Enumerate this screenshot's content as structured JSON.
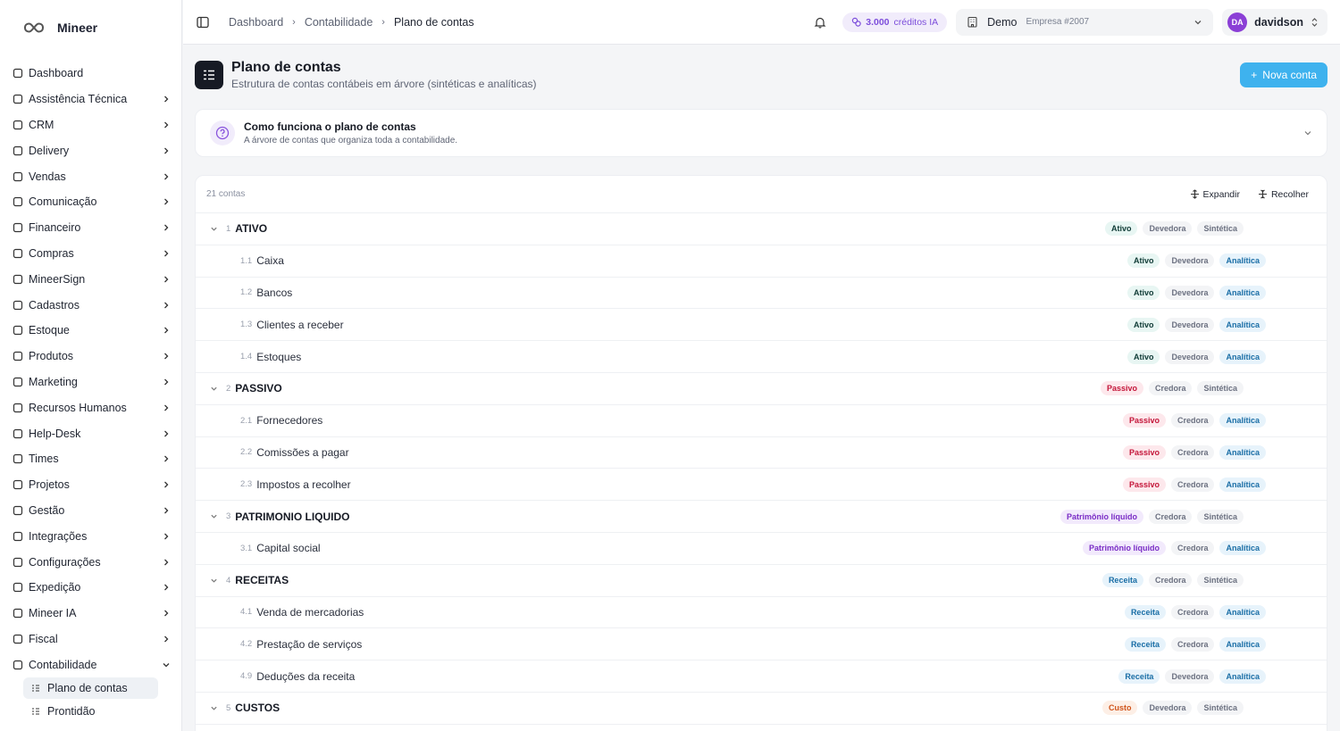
{
  "brand": {
    "name": "Mineer"
  },
  "sidebar": {
    "items": [
      {
        "label": "Dashboard",
        "icon": "dashboard-icon",
        "chevron": false
      },
      {
        "label": "Assistência Técnica",
        "icon": "wrench-icon",
        "chevron": true
      },
      {
        "label": "CRM",
        "icon": "users-icon",
        "chevron": true
      },
      {
        "label": "Delivery",
        "icon": "bike-icon",
        "chevron": true
      },
      {
        "label": "Vendas",
        "icon": "trending-up-icon",
        "chevron": true
      },
      {
        "label": "Comunicação",
        "icon": "radio-icon",
        "chevron": true
      },
      {
        "label": "Financeiro",
        "icon": "credit-card-icon",
        "chevron": true
      },
      {
        "label": "Compras",
        "icon": "cart-icon",
        "chevron": true
      },
      {
        "label": "MineerSign",
        "icon": "signature-icon",
        "chevron": true
      },
      {
        "label": "Cadastros",
        "icon": "database-icon",
        "chevron": true
      },
      {
        "label": "Estoque",
        "icon": "package-icon",
        "chevron": true
      },
      {
        "label": "Produtos",
        "icon": "box-icon",
        "chevron": true
      },
      {
        "label": "Marketing",
        "icon": "megaphone-icon",
        "chevron": true
      },
      {
        "label": "Recursos Humanos",
        "icon": "briefcase-icon",
        "chevron": true
      },
      {
        "label": "Help-Desk",
        "icon": "headset-icon",
        "chevron": true
      },
      {
        "label": "Times",
        "icon": "team-icon",
        "chevron": true
      },
      {
        "label": "Projetos",
        "icon": "folder-icon",
        "chevron": true
      },
      {
        "label": "Gestão",
        "icon": "clipboard-icon",
        "chevron": true
      },
      {
        "label": "Integrações",
        "icon": "command-icon",
        "chevron": true
      },
      {
        "label": "Configurações",
        "icon": "gear-icon",
        "chevron": true
      },
      {
        "label": "Expedição",
        "icon": "truck-icon",
        "chevron": true
      },
      {
        "label": "Mineer IA",
        "icon": "bot-icon",
        "chevron": true
      },
      {
        "label": "Fiscal",
        "icon": "receipt-icon",
        "chevron": true
      },
      {
        "label": "Contabilidade",
        "icon": "calculator-icon",
        "chevron": true,
        "expanded": true
      }
    ],
    "subitems": [
      {
        "label": "Plano de contas",
        "icon": "list-tree-icon",
        "active": true
      },
      {
        "label": "Prontidão",
        "icon": "shield-icon",
        "active": false
      }
    ]
  },
  "topbar": {
    "breadcrumbs": [
      "Dashboard",
      "Contabilidade",
      "Plano de contas"
    ],
    "credits_amount": "3.000",
    "credits_label": "créditos IA",
    "company_name": "Demo",
    "company_sub": "Empresa #2007",
    "user_initials": "DA",
    "user_name": "davidson"
  },
  "page": {
    "title": "Plano de contas",
    "subtitle": "Estrutura de contas contábeis em árvore (sintéticas e analíticas)",
    "new_button": "Nova conta"
  },
  "help": {
    "title": "Como funciona o plano de contas",
    "subtitle": "A árvore de contas que organiza toda a contabilidade."
  },
  "table": {
    "count": "21 contas",
    "expand_label": "Expandir",
    "collapse_label": "Recolher",
    "rows": [
      {
        "level": "group",
        "code": "1",
        "name": "ATIVO",
        "type": "Ativo",
        "type_class": "b-ativo",
        "nature": "Devedora",
        "kind": "Sintética"
      },
      {
        "level": "child",
        "code": "1.1",
        "name": "Caixa",
        "type": "Ativo",
        "type_class": "b-ativo",
        "nature": "Devedora",
        "kind": "Analítica"
      },
      {
        "level": "child",
        "code": "1.2",
        "name": "Bancos",
        "type": "Ativo",
        "type_class": "b-ativo",
        "nature": "Devedora",
        "kind": "Analítica"
      },
      {
        "level": "child",
        "code": "1.3",
        "name": "Clientes a receber",
        "type": "Ativo",
        "type_class": "b-ativo",
        "nature": "Devedora",
        "kind": "Analítica"
      },
      {
        "level": "child",
        "code": "1.4",
        "name": "Estoques",
        "type": "Ativo",
        "type_class": "b-ativo",
        "nature": "Devedora",
        "kind": "Analítica"
      },
      {
        "level": "group",
        "code": "2",
        "name": "PASSIVO",
        "type": "Passivo",
        "type_class": "b-passivo",
        "nature": "Credora",
        "kind": "Sintética"
      },
      {
        "level": "child",
        "code": "2.1",
        "name": "Fornecedores",
        "type": "Passivo",
        "type_class": "b-passivo",
        "nature": "Credora",
        "kind": "Analítica"
      },
      {
        "level": "child",
        "code": "2.2",
        "name": "Comissões a pagar",
        "type": "Passivo",
        "type_class": "b-passivo",
        "nature": "Credora",
        "kind": "Analítica"
      },
      {
        "level": "child",
        "code": "2.3",
        "name": "Impostos a recolher",
        "type": "Passivo",
        "type_class": "b-passivo",
        "nature": "Credora",
        "kind": "Analítica"
      },
      {
        "level": "group",
        "code": "3",
        "name": "PATRIMONIO LIQUIDO",
        "type": "Patrimônio líquido",
        "type_class": "b-pl",
        "nature": "Credora",
        "kind": "Sintética"
      },
      {
        "level": "child",
        "code": "3.1",
        "name": "Capital social",
        "type": "Patrimônio líquido",
        "type_class": "b-pl",
        "nature": "Credora",
        "kind": "Analítica"
      },
      {
        "level": "group",
        "code": "4",
        "name": "RECEITAS",
        "type": "Receita",
        "type_class": "b-receita",
        "nature": "Credora",
        "kind": "Sintética"
      },
      {
        "level": "child",
        "code": "4.1",
        "name": "Venda de mercadorias",
        "type": "Receita",
        "type_class": "b-receita",
        "nature": "Credora",
        "kind": "Analítica"
      },
      {
        "level": "child",
        "code": "4.2",
        "name": "Prestação de serviços",
        "type": "Receita",
        "type_class": "b-receita",
        "nature": "Credora",
        "kind": "Analítica"
      },
      {
        "level": "child",
        "code": "4.9",
        "name": "Deduções da receita",
        "type": "Receita",
        "type_class": "b-receita",
        "nature": "Devedora",
        "kind": "Analítica"
      },
      {
        "level": "group",
        "code": "5",
        "name": "CUSTOS",
        "type": "Custo",
        "type_class": "b-custo",
        "nature": "Devedora",
        "kind": "Sintética"
      }
    ]
  },
  "colors": {
    "accent": "#3eb2ee",
    "credits_bg": "#f1ecfb",
    "credits_text": "#7c4ddb",
    "avatar": "#8b3fd6"
  }
}
